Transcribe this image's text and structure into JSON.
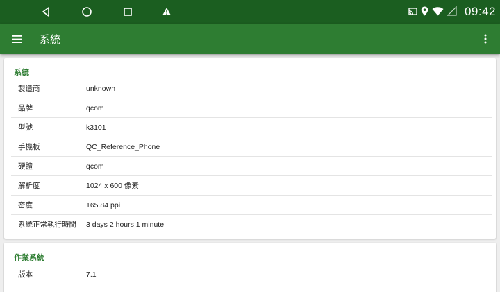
{
  "status_bar": {
    "clock": "09:42",
    "icons": [
      "back-icon",
      "home-icon",
      "recents-icon",
      "warning-icon",
      "cast-icon",
      "location-icon",
      "wifi-icon",
      "signal-icon"
    ]
  },
  "app_bar": {
    "title": "系統",
    "icons": [
      "hamburger-menu-icon",
      "overflow-menu-icon"
    ]
  },
  "colors": {
    "status_bar": "#1b5e20",
    "app_bar": "#2e7d32",
    "accent": "#2e7d32",
    "background": "#eeeeee"
  },
  "sections": [
    {
      "title": "系統",
      "rows": [
        {
          "label": "製造商",
          "value": "unknown"
        },
        {
          "label": "品牌",
          "value": "qcom"
        },
        {
          "label": "型號",
          "value": "k3101"
        },
        {
          "label": "手機板",
          "value": "QC_Reference_Phone"
        },
        {
          "label": "硬體",
          "value": "qcom"
        },
        {
          "label": "解析度",
          "value": "1024 x 600 像素"
        },
        {
          "label": "密度",
          "value": "165.84 ppi"
        },
        {
          "label": "系統正常執行時間",
          "value": "3 days 2 hours 1 minute"
        }
      ]
    },
    {
      "title": "作業系統",
      "rows": [
        {
          "label": "版本",
          "value": "7.1"
        }
      ]
    }
  ]
}
